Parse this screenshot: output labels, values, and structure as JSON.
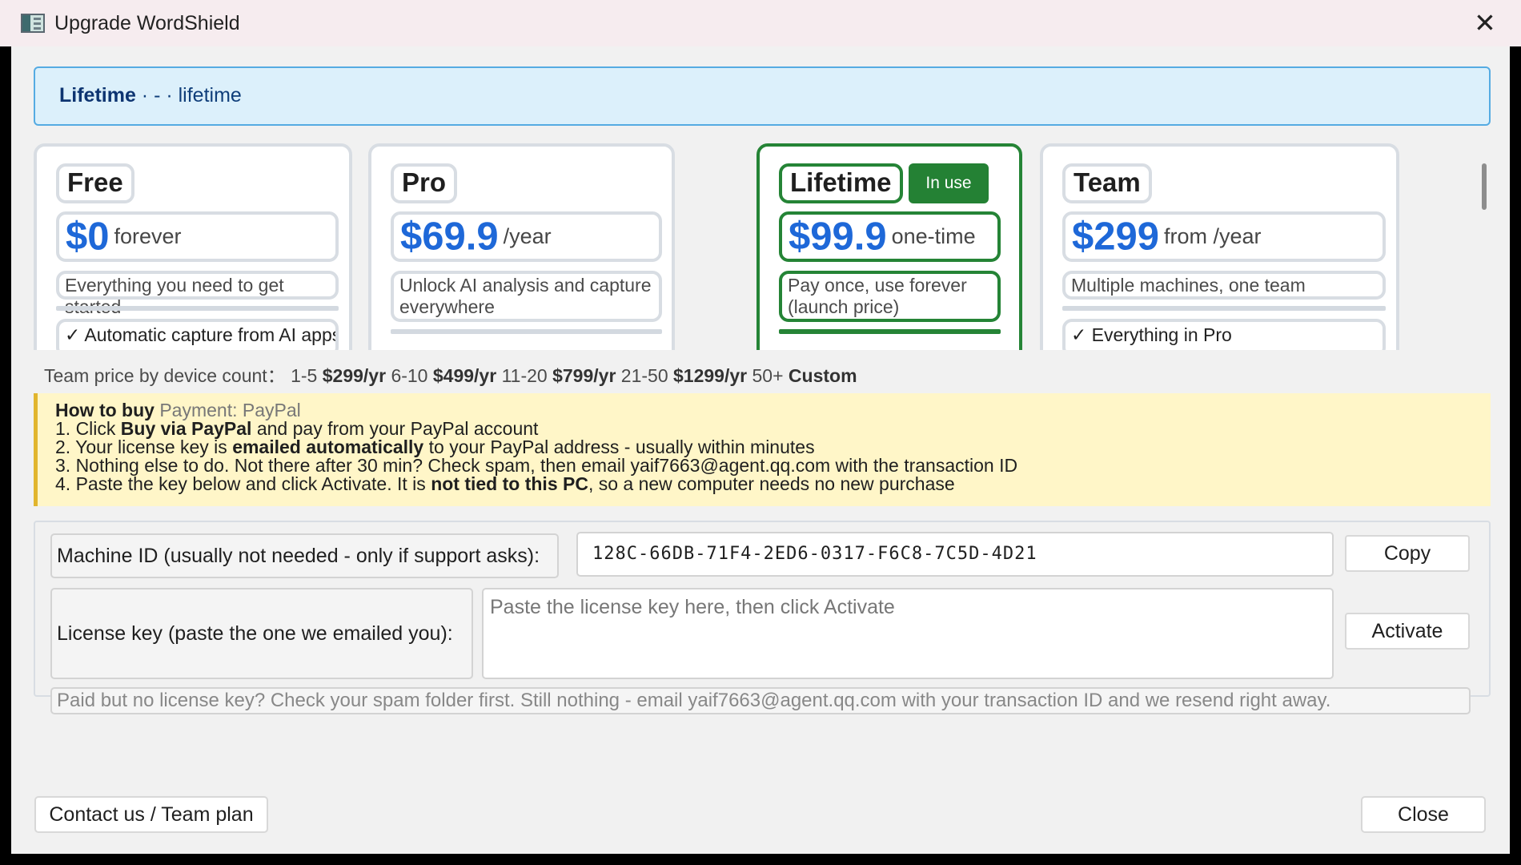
{
  "window": {
    "title": "Upgrade WordShield",
    "close_symbol": "✕"
  },
  "current_plan": {
    "plan": "Lifetime",
    "separator": " · - · ",
    "detail": "lifetime"
  },
  "plans": [
    {
      "name": "Free",
      "price": "$0",
      "period": "forever",
      "description": "Everything you need to get started",
      "feature": "✓ Automatic capture from AI apps"
    },
    {
      "name": "Pro",
      "price": "$69.9",
      "period": "/year",
      "description": "Unlock AI analysis and capture everywhere"
    },
    {
      "name": "Lifetime",
      "badge": "In use",
      "price": "$99.9",
      "period": "one-time",
      "description": "Pay once, use forever (launch price)"
    },
    {
      "name": "Team",
      "price": "$299",
      "period": "from /year",
      "description": "Multiple machines, one team",
      "feature": "✓ Everything in Pro"
    }
  ],
  "team_price": {
    "label": "Team price by device count：",
    "tiers": [
      {
        "range": "1-5",
        "price": "$299/yr"
      },
      {
        "range": "6-10",
        "price": "$499/yr"
      },
      {
        "range": "11-20",
        "price": "$799/yr"
      },
      {
        "range": "21-50",
        "price": "$1299/yr"
      },
      {
        "range": "50+",
        "price": "Custom"
      }
    ]
  },
  "how_to_buy": {
    "heading": "How to buy",
    "payment": "Payment: PayPal",
    "step1_a": "1. Click ",
    "step1_b": "Buy via PayPal",
    "step1_c": " and pay from your PayPal account",
    "step2_a": "2. Your license key is ",
    "step2_b": "emailed automatically",
    "step2_c": " to your PayPal address - usually within minutes",
    "step3": "3. Nothing else to do. Not there after 30 min? Check spam, then email yaif7663@agent.qq.com with the transaction ID",
    "step4_a": "4. Paste the key below and click Activate. It is ",
    "step4_b": "not tied to this PC",
    "step4_c": ", so a new computer needs no new purchase"
  },
  "license": {
    "machine_label": "Machine ID (usually not needed - only if support asks):",
    "machine_id": "128C-66DB-71F4-2ED6-0317-F6C8-7C5D-4D21",
    "copy_label": "Copy",
    "key_label": "License key (paste the one we emailed you):",
    "key_placeholder": "Paste the license key here, then click Activate",
    "activate_label": "Activate",
    "help": "Paid but no license key? Check your spam folder first. Still nothing - email yaif7663@agent.qq.com with your transaction ID and we resend right away."
  },
  "footer": {
    "contact_label": "Contact us / Team plan",
    "close_label": "Close"
  },
  "colors": {
    "accent": "#1E68D8",
    "active_plan": "#258436",
    "banner": "#DCF0FB",
    "instructions": "#FFF6C8"
  }
}
